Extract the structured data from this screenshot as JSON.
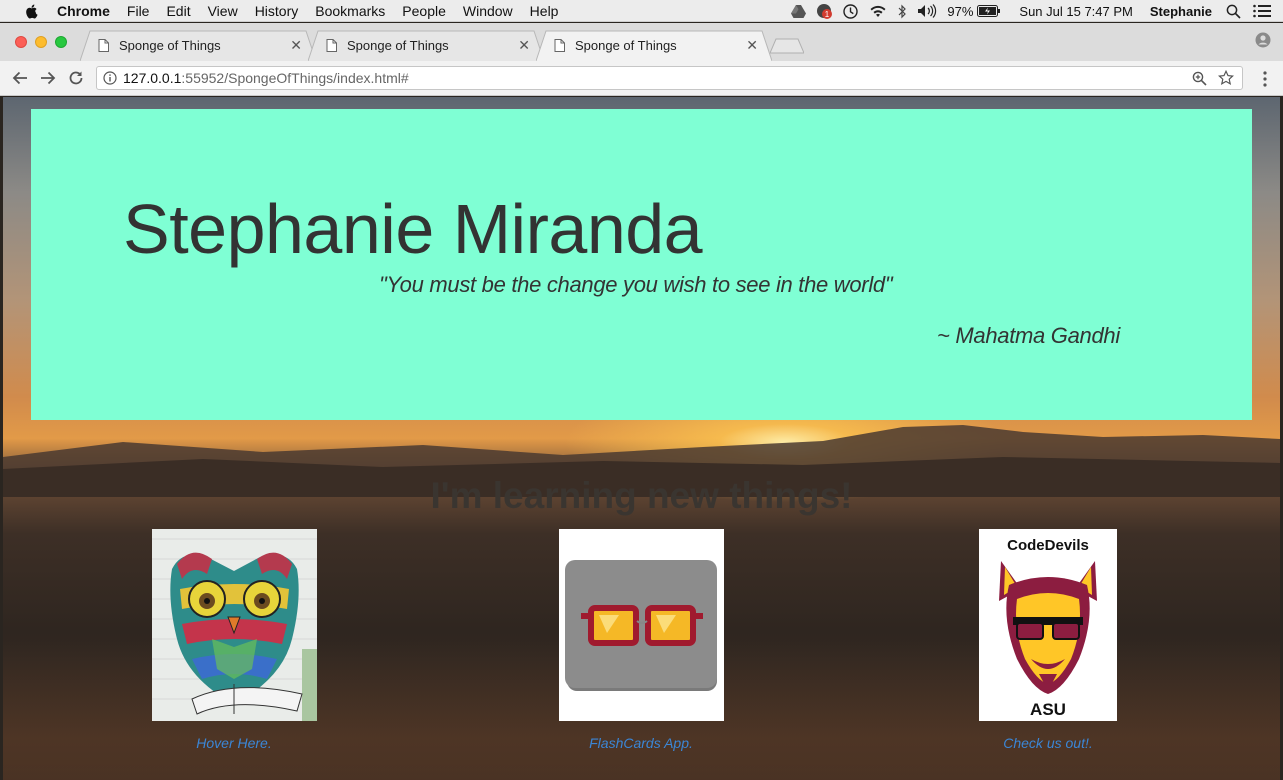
{
  "menubar": {
    "app_name": "Chrome",
    "items": [
      "File",
      "Edit",
      "View",
      "History",
      "Bookmarks",
      "People",
      "Window",
      "Help"
    ],
    "battery": "97%",
    "clock": "Sun Jul 15  7:47 PM",
    "user": "Stephanie",
    "notification_badge": "1"
  },
  "browser": {
    "tabs": [
      {
        "title": "Sponge of Things",
        "active": false
      },
      {
        "title": "Sponge of Things",
        "active": false
      },
      {
        "title": "Sponge of Things",
        "active": true
      }
    ],
    "url_host": "127.0.0.1",
    "url_rest": ":55952/SpongeOfThings/index.html#"
  },
  "hero": {
    "name": "Stephanie Miranda",
    "quote": "\"You must be the change you wish to see in the world\"",
    "author": "~ Mahatma Gandhi",
    "background": "#7fffd4"
  },
  "projects": {
    "heading": "I'm learning new things!",
    "items": [
      {
        "caption": "Hover Here.",
        "image": "owl-icon"
      },
      {
        "caption": "FlashCards App.",
        "image": "glasses-icon"
      },
      {
        "caption": "Check us out!.",
        "image": "sun-devil-icon",
        "logo_top": "CodeDevils",
        "logo_bottom": "ASU"
      }
    ]
  },
  "colors": {
    "link": "#3b86d6",
    "accent": "#7fffd4",
    "devil_maroon": "#8c1d40",
    "devil_gold": "#ffc627"
  }
}
